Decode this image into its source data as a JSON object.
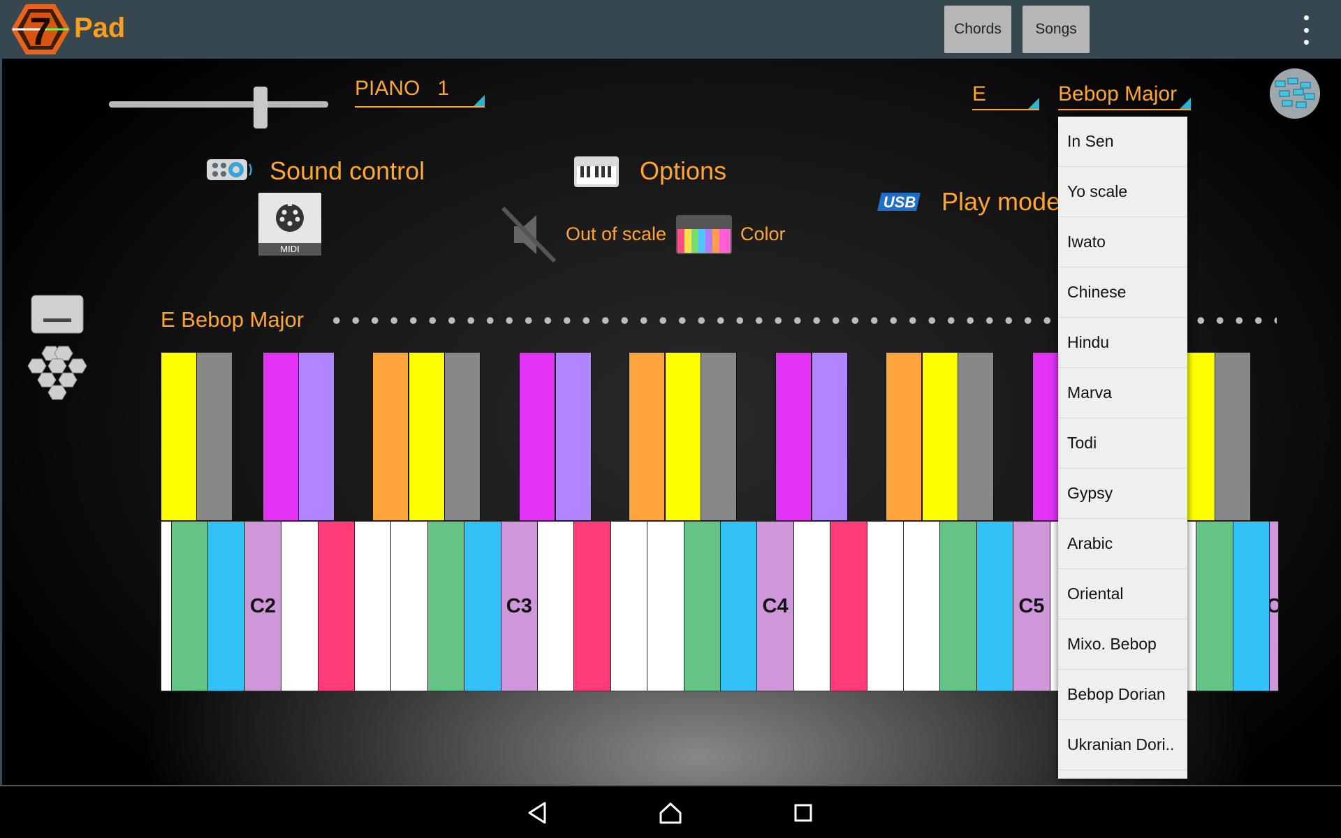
{
  "app": {
    "title": "Pad",
    "logo_digit": "7"
  },
  "toolbar": {
    "chords_label": "Chords",
    "songs_label": "Songs",
    "overflow_icon": "overflow-menu-icon"
  },
  "controls": {
    "volume_level": 0.69,
    "instrument": "PIANO   1",
    "key": "E",
    "scale": "Bebop Major",
    "sound_control_label": "Sound control",
    "midi_label": "MIDI",
    "options_label": "Options",
    "out_of_scale_label": "Out of scale",
    "color_label": "Color",
    "play_mode_label": "Play mode",
    "usb_label": "USB"
  },
  "scale_title": "E Bebop Major",
  "colors": {
    "accent": "#ffa531",
    "toolbar_bg": "#37474f",
    "spinner_triangle": "#29b6d6"
  },
  "keyboard": {
    "upper_keys": [
      {
        "color": "#ffff00"
      },
      {
        "color": "#888888"
      },
      {
        "color": "#e333f5"
      },
      {
        "color": "#b085ff"
      },
      {
        "color": "#ffa53b"
      },
      {
        "color": "#ffff00"
      },
      {
        "color": "#888888"
      },
      {
        "color": "#e333f5"
      },
      {
        "color": "#b085ff"
      },
      {
        "color": "#ffa53b"
      },
      {
        "color": "#ffff00"
      },
      {
        "color": "#888888"
      },
      {
        "color": "#e333f5"
      },
      {
        "color": "#b085ff"
      },
      {
        "color": "#ffa53b"
      },
      {
        "color": "#ffff00"
      },
      {
        "color": "#888888"
      },
      {
        "color": "#e333f5"
      },
      {
        "color": "#b085ff"
      },
      {
        "color": "#ffa53b"
      },
      {
        "color": "#ffff00"
      },
      {
        "color": "#888888"
      }
    ],
    "lower_keys": [
      {
        "color": "#ffffff",
        "label": ""
      },
      {
        "color": "#66c386",
        "label": ""
      },
      {
        "color": "#33c2f8",
        "label": ""
      },
      {
        "color": "#d096da",
        "label": "C2"
      },
      {
        "color": "#ffffff",
        "label": ""
      },
      {
        "color": "#ff3c78",
        "label": ""
      },
      {
        "color": "#ffffff",
        "label": ""
      },
      {
        "color": "#ffffff",
        "label": ""
      },
      {
        "color": "#66c386",
        "label": ""
      },
      {
        "color": "#33c2f8",
        "label": ""
      },
      {
        "color": "#d096da",
        "label": "C3"
      },
      {
        "color": "#ffffff",
        "label": ""
      },
      {
        "color": "#ff3c78",
        "label": ""
      },
      {
        "color": "#ffffff",
        "label": ""
      },
      {
        "color": "#ffffff",
        "label": ""
      },
      {
        "color": "#66c386",
        "label": ""
      },
      {
        "color": "#33c2f8",
        "label": ""
      },
      {
        "color": "#d096da",
        "label": "C4"
      },
      {
        "color": "#ffffff",
        "label": ""
      },
      {
        "color": "#ff3c78",
        "label": ""
      },
      {
        "color": "#ffffff",
        "label": ""
      },
      {
        "color": "#ffffff",
        "label": ""
      },
      {
        "color": "#66c386",
        "label": ""
      },
      {
        "color": "#33c2f8",
        "label": ""
      },
      {
        "color": "#d096da",
        "label": "C5"
      },
      {
        "color": "#ffffff",
        "label": ""
      },
      {
        "color": "#ff3c78",
        "label": ""
      },
      {
        "color": "#ffffff",
        "label": ""
      },
      {
        "color": "#ffffff",
        "label": ""
      },
      {
        "color": "#66c386",
        "label": ""
      },
      {
        "color": "#33c2f8",
        "label": ""
      },
      {
        "color": "#d096da",
        "label": "C"
      }
    ]
  },
  "dropdown": {
    "items": [
      "In Sen",
      "Yo scale",
      "Iwato",
      "Chinese",
      "Hindu",
      "Marva",
      "Todi",
      "Gypsy",
      "Arabic",
      "Oriental",
      "Mixo. Bebop",
      "Bebop Dorian",
      "Ukranian Dori.."
    ]
  },
  "navbar": {
    "back_icon": "back-icon",
    "home_icon": "home-icon",
    "recents_icon": "recents-icon"
  }
}
